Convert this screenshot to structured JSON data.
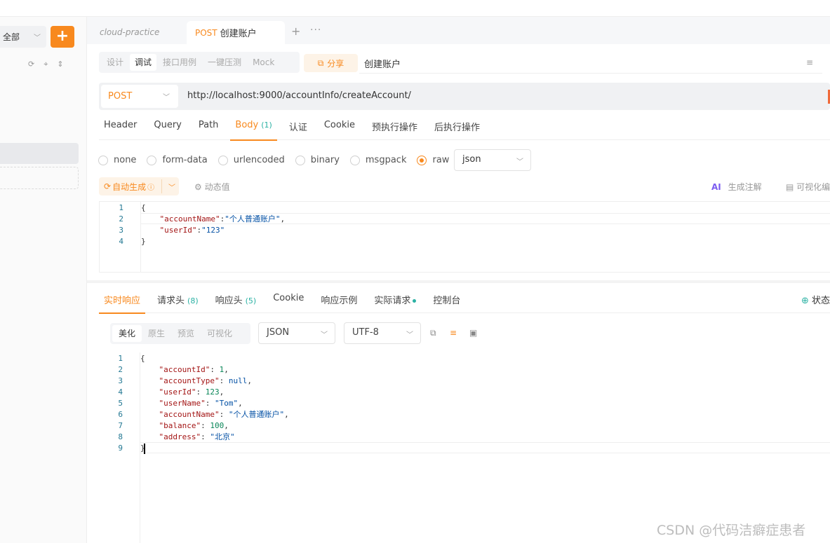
{
  "sidebar": {
    "filter_label": "全部",
    "add_label": "+"
  },
  "tabs": {
    "inactive_label": "cloud-practice",
    "active_method": "POST",
    "active_label": "创建账户",
    "add_label": "+",
    "more_label": "···"
  },
  "modes": [
    {
      "label": "设计",
      "active": false
    },
    {
      "label": "调试",
      "active": true
    },
    {
      "label": "接口用例",
      "active": false
    },
    {
      "label": "一键压测",
      "active": false
    },
    {
      "label": "Mock",
      "active": false
    }
  ],
  "share_label": "分享",
  "api_name": "创建账户",
  "request": {
    "method": "POST",
    "url": "http://localhost:9000/accountInfo/createAccount/",
    "tabs": [
      "Header",
      "Query",
      "Path",
      "Body",
      "认证",
      "Cookie",
      "预执行操作",
      "后执行操作"
    ],
    "body_count": "(1)",
    "body_types": [
      "none",
      "form-data",
      "urlencoded",
      "binary",
      "msgpack",
      "raw"
    ],
    "selected_body_type": "raw",
    "format": "json",
    "auto_generate_label": "自动生成",
    "dynamic_value_label": "动态值",
    "ai_label": "AI",
    "generate_annotation_label": "生成注解",
    "visual_edit_label": "可视化编",
    "body_lines": [
      [
        {
          "t": "{",
          "c": "p"
        }
      ],
      [
        {
          "t": "    ",
          "c": "p"
        },
        {
          "t": "\"accountName\"",
          "c": "k"
        },
        {
          "t": ":",
          "c": "p"
        },
        {
          "t": "\"个人普通账户\"",
          "c": "s"
        },
        {
          "t": ",",
          "c": "p"
        }
      ],
      [
        {
          "t": "    ",
          "c": "p"
        },
        {
          "t": "\"userId\"",
          "c": "k"
        },
        {
          "t": ":",
          "c": "p"
        },
        {
          "t": "\"123\"",
          "c": "s"
        }
      ],
      [
        {
          "t": "}",
          "c": "p"
        }
      ]
    ]
  },
  "response": {
    "tabs": [
      {
        "label": "实时响应",
        "count": "",
        "dot": false,
        "active": true
      },
      {
        "label": "请求头",
        "count": "(8)",
        "dot": false,
        "active": false
      },
      {
        "label": "响应头",
        "count": "(5)",
        "dot": false,
        "active": false
      },
      {
        "label": "Cookie",
        "count": "",
        "dot": false,
        "active": false
      },
      {
        "label": "响应示例",
        "count": "",
        "dot": false,
        "active": false
      },
      {
        "label": "实际请求",
        "count": "",
        "dot": true,
        "active": false
      },
      {
        "label": "控制台",
        "count": "",
        "dot": false,
        "active": false
      }
    ],
    "status_label": "状态",
    "view_modes": [
      {
        "label": "美化",
        "active": true
      },
      {
        "label": "原生",
        "active": false
      },
      {
        "label": "预览",
        "active": false
      },
      {
        "label": "可视化",
        "active": false
      }
    ],
    "format": "JSON",
    "encoding": "UTF-8",
    "lines": [
      [
        {
          "t": "{",
          "c": "p"
        }
      ],
      [
        {
          "t": "    ",
          "c": "p"
        },
        {
          "t": "\"accountId\"",
          "c": "k"
        },
        {
          "t": ": ",
          "c": "p"
        },
        {
          "t": "1",
          "c": "n"
        },
        {
          "t": ",",
          "c": "p"
        }
      ],
      [
        {
          "t": "    ",
          "c": "p"
        },
        {
          "t": "\"accountType\"",
          "c": "k"
        },
        {
          "t": ": ",
          "c": "p"
        },
        {
          "t": "null",
          "c": "s"
        },
        {
          "t": ",",
          "c": "p"
        }
      ],
      [
        {
          "t": "    ",
          "c": "p"
        },
        {
          "t": "\"userId\"",
          "c": "k"
        },
        {
          "t": ": ",
          "c": "p"
        },
        {
          "t": "123",
          "c": "n"
        },
        {
          "t": ",",
          "c": "p"
        }
      ],
      [
        {
          "t": "    ",
          "c": "p"
        },
        {
          "t": "\"userName\"",
          "c": "k"
        },
        {
          "t": ": ",
          "c": "p"
        },
        {
          "t": "\"Tom\"",
          "c": "s"
        },
        {
          "t": ",",
          "c": "p"
        }
      ],
      [
        {
          "t": "    ",
          "c": "p"
        },
        {
          "t": "\"accountName\"",
          "c": "k"
        },
        {
          "t": ": ",
          "c": "p"
        },
        {
          "t": "\"个人普通账户\"",
          "c": "s"
        },
        {
          "t": ",",
          "c": "p"
        }
      ],
      [
        {
          "t": "    ",
          "c": "p"
        },
        {
          "t": "\"balance\"",
          "c": "k"
        },
        {
          "t": ": ",
          "c": "p"
        },
        {
          "t": "100",
          "c": "n"
        },
        {
          "t": ",",
          "c": "p"
        }
      ],
      [
        {
          "t": "    ",
          "c": "p"
        },
        {
          "t": "\"address\"",
          "c": "k"
        },
        {
          "t": ": ",
          "c": "p"
        },
        {
          "t": "\"北京\"",
          "c": "s"
        }
      ],
      [
        {
          "t": "}",
          "c": "p"
        }
      ]
    ]
  },
  "watermark": "CSDN @代码洁癖症患者",
  "colors": {
    "accent": "#f8891e",
    "count": "#2ab1a3"
  }
}
